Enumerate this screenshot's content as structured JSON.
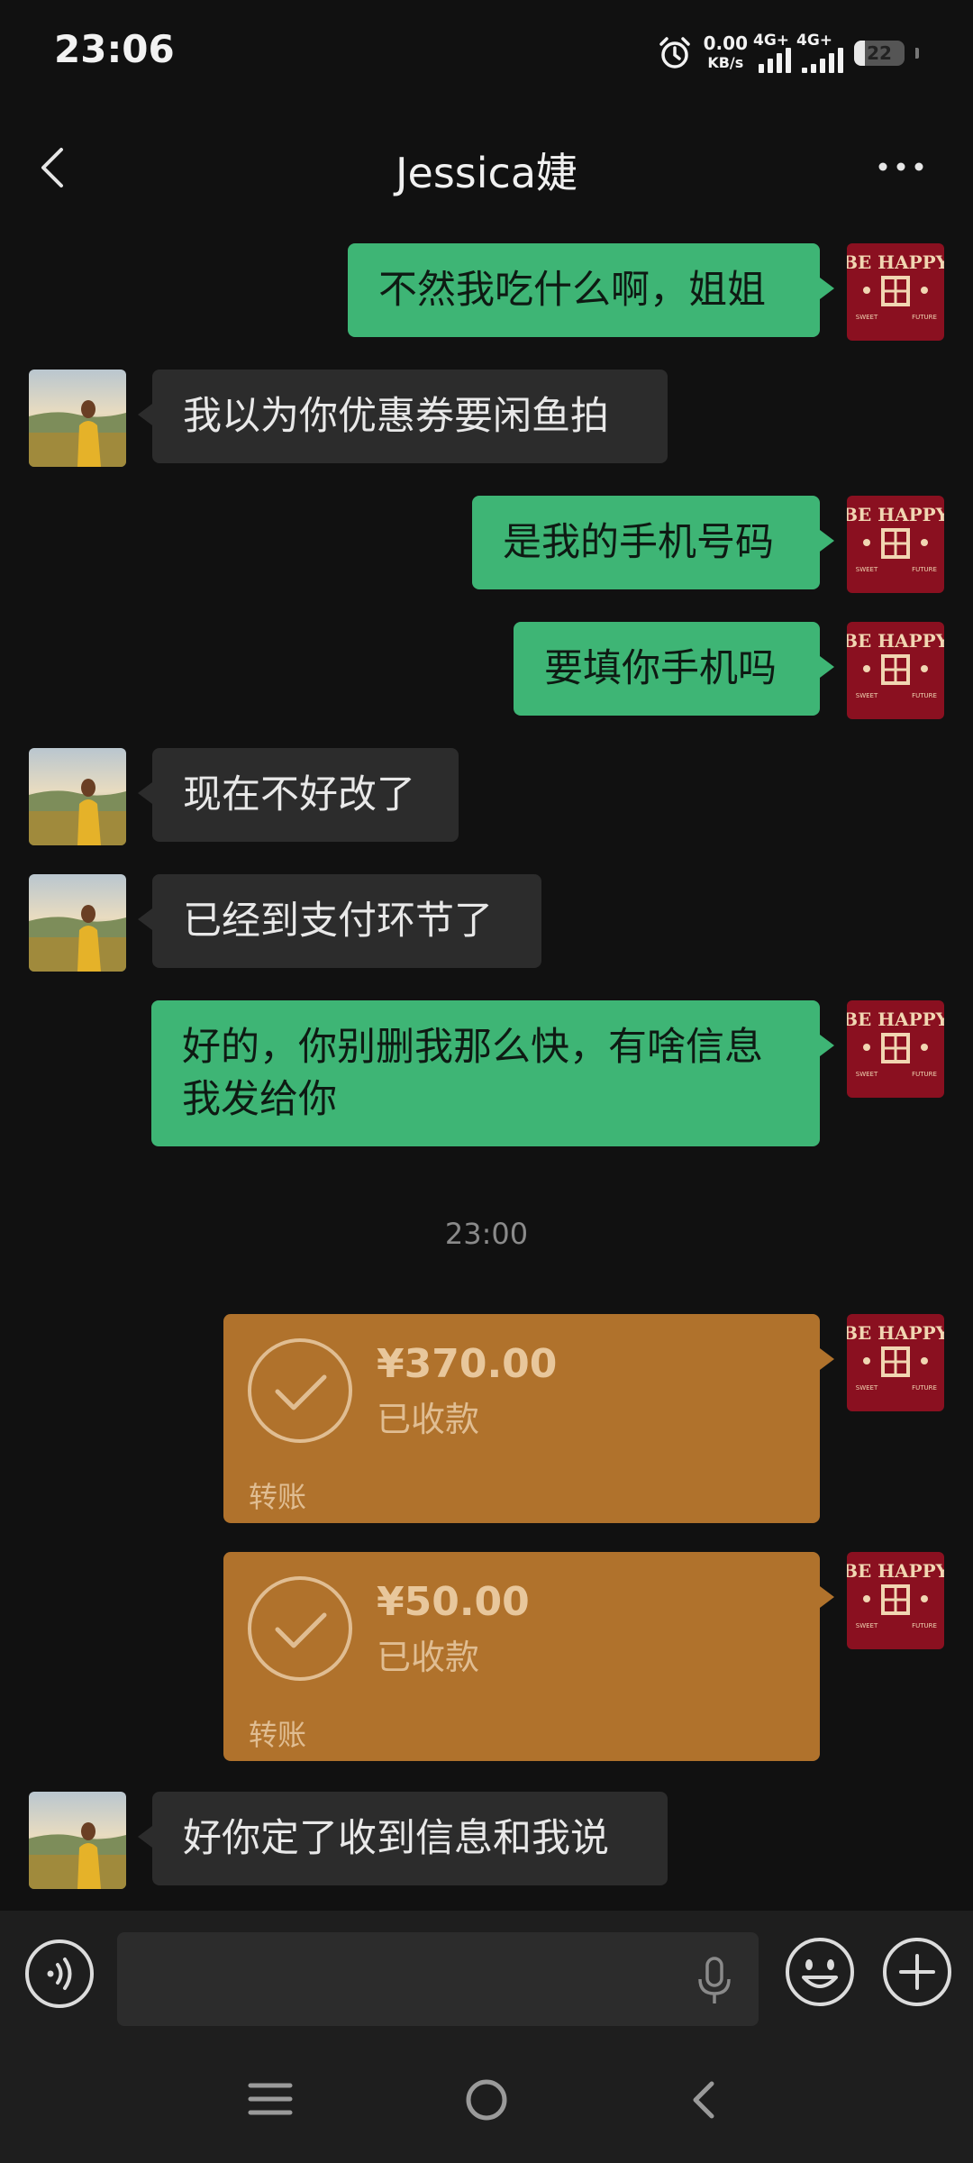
{
  "status_bar": {
    "time": "23:06",
    "net_speed_value": "0.00",
    "net_speed_unit": "KB/s",
    "sim1": "4G+",
    "sim2": "4G+",
    "battery": "22"
  },
  "header": {
    "title": "Jessica婕",
    "back_icon": "chevron-left-icon",
    "more_icon": "more-horizontal-icon"
  },
  "messages": [
    {
      "from": "self",
      "text": "不然我吃什么啊，姐姐"
    },
    {
      "from": "other",
      "text": "我以为你优惠券要闲鱼拍"
    },
    {
      "from": "self",
      "text": "是我的手机号码"
    },
    {
      "from": "self",
      "text": "要填你手机吗"
    },
    {
      "from": "other",
      "text": "现在不好改了"
    },
    {
      "from": "other",
      "text": "已经到支付环节了"
    },
    {
      "from": "self",
      "text_line1": "好的，你别删我那么快，有啥信息",
      "text_line2": "我发给你"
    }
  ],
  "time_separator": "23:00",
  "transfers": [
    {
      "amount": "¥370.00",
      "status": "已收款",
      "kind": "转账"
    },
    {
      "amount": "¥50.00",
      "status": "已收款",
      "kind": "转账"
    }
  ],
  "last_message": {
    "from": "other",
    "text": "好你定了收到信息和我说"
  },
  "avatars": {
    "self_text_top": "BE HAPPY",
    "self_text_bottom_left": "SWEET",
    "self_text_bottom_right": "FUTURE"
  },
  "input": {
    "placeholder": "",
    "value": ""
  },
  "colors": {
    "background": "#111111",
    "self_bubble": "#3eb575",
    "other_bubble": "#2c2c2c",
    "transfer_card": "#b0722c"
  }
}
